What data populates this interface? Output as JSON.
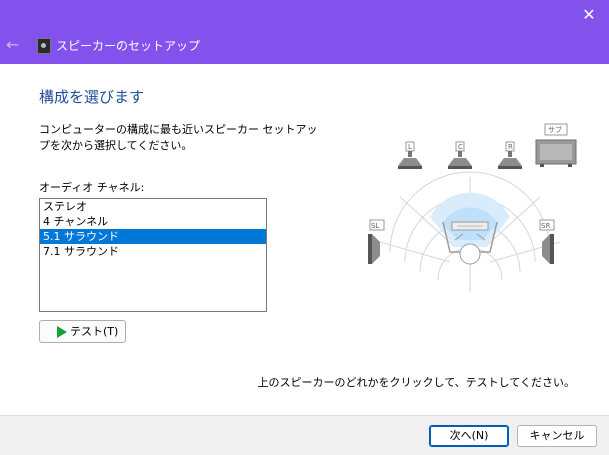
{
  "window": {
    "title": "スピーカーのセットアップ",
    "close_glyph": "✕",
    "back_glyph": "←",
    "accent_color": "#8352ec"
  },
  "page": {
    "heading": "構成を選びます",
    "instruction": "コンピューターの構成に最も近いスピーカー セットアップを次から選択してください。",
    "channel_label": "オーディオ チャネル:",
    "channels": [
      "ステレオ",
      "4 チャンネル",
      "5.1 サラウンド",
      "7.1 サラウンド"
    ],
    "selected_channel": "5.1 サラウンド",
    "test_button": "テスト(T)",
    "hint": "上のスピーカーのどれかをクリックして、テストしてください。"
  },
  "speakers": {
    "front_left": "L",
    "center": "C",
    "front_right": "R",
    "subwoofer": "サブ",
    "surround_left": "SL",
    "surround_right": "SR"
  },
  "footer": {
    "next_button": "次へ(N)",
    "cancel_button": "キャンセル"
  }
}
